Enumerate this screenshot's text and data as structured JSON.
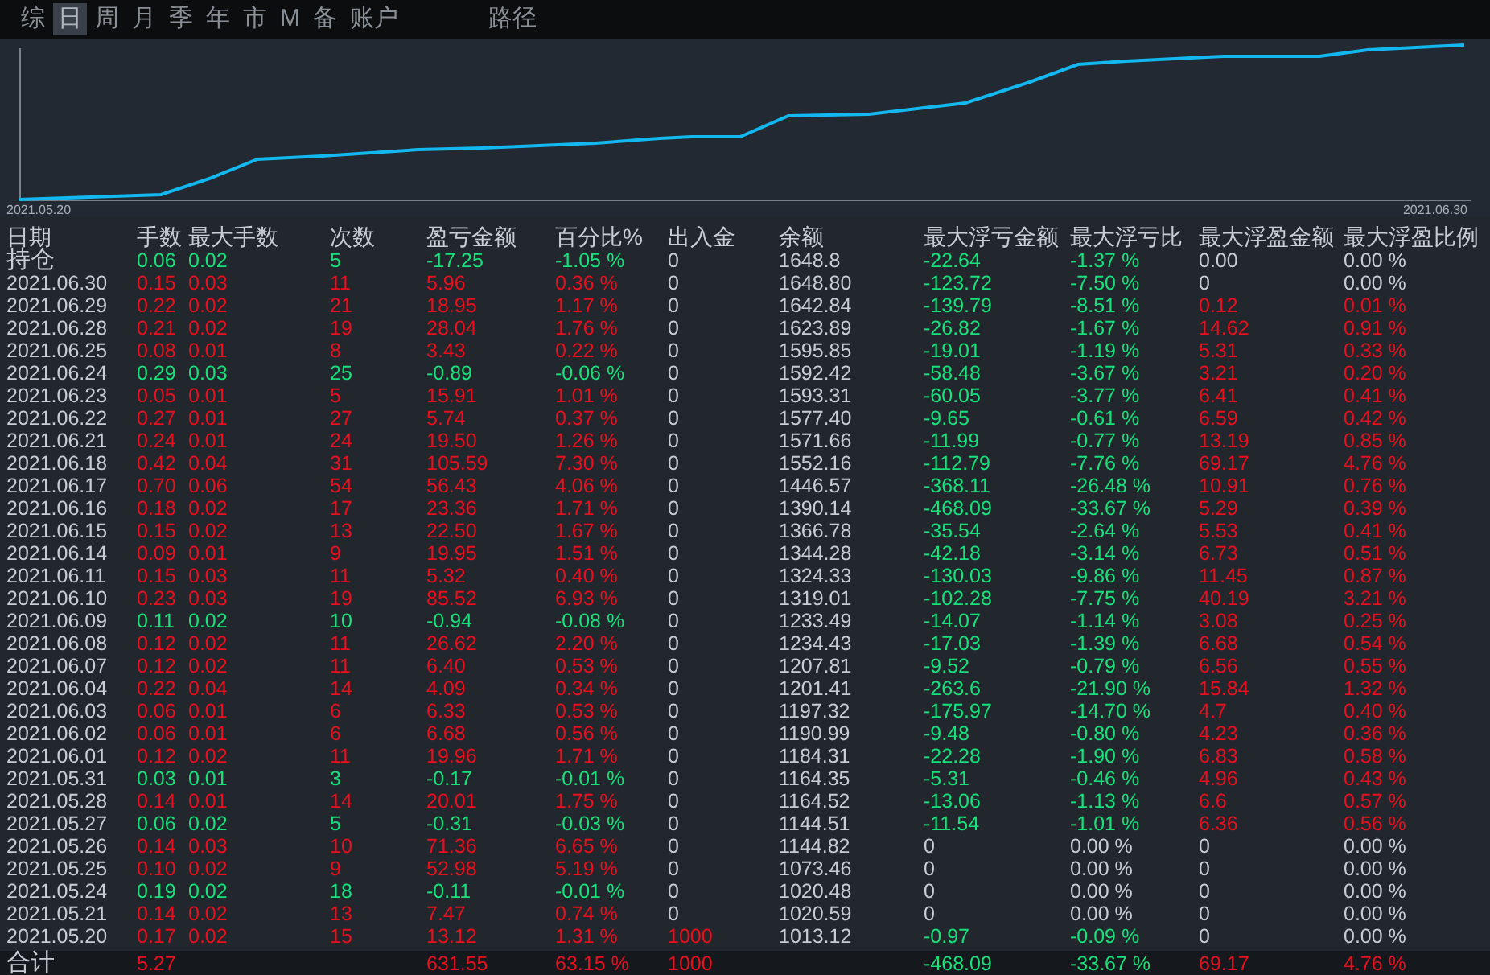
{
  "tabs": [
    {
      "label": "综",
      "selected": false
    },
    {
      "label": "日",
      "selected": true
    },
    {
      "label": "周",
      "selected": false
    },
    {
      "label": "月",
      "selected": false
    },
    {
      "label": "季",
      "selected": false
    },
    {
      "label": "年",
      "selected": false
    },
    {
      "label": "市",
      "selected": false
    },
    {
      "label": "M",
      "selected": false
    },
    {
      "label": "备",
      "selected": false
    },
    {
      "label": "账户",
      "selected": false
    },
    {
      "label": "路径",
      "selected": false
    }
  ],
  "chart": {
    "start_label": "2021.05.20",
    "end_label": "2021.06.30"
  },
  "table": {
    "columns": [
      "日期",
      "手数",
      "最大手数",
      "次数",
      "盈亏金额",
      "百分比%",
      "出入金",
      "余额",
      "最大浮亏金额",
      "最大浮亏比",
      "最大浮盈金额",
      "最大浮盈比例"
    ],
    "rows": [
      [
        {
          "text": "持仓",
          "color": "#c8ccd4"
        },
        {
          "text": "0.06",
          "color": "#18e07a"
        },
        {
          "text": "0.02",
          "color": "#18e07a"
        },
        {
          "text": "5",
          "color": "#18e07a"
        },
        {
          "text": "-17.25",
          "color": "#18e07a"
        },
        {
          "text": "-1.05 %",
          "color": "#18e07a"
        },
        {
          "text": "0",
          "color": "#c8ccd4"
        },
        {
          "text": "1648.8",
          "color": "#c8ccd4"
        },
        {
          "text": "-22.64",
          "color": "#18e07a"
        },
        {
          "text": "-1.37 %",
          "color": "#18e07a"
        },
        {
          "text": "0.00",
          "color": "#c8ccd4"
        },
        {
          "text": "0.00 %",
          "color": "#c8ccd4"
        }
      ],
      [
        {
          "text": "2021.06.30",
          "color": "#c8ccd4"
        },
        {
          "text": "0.15",
          "color": "#e8101e"
        },
        {
          "text": "0.03",
          "color": "#e8101e"
        },
        {
          "text": "11",
          "color": "#e8101e"
        },
        {
          "text": "5.96",
          "color": "#e8101e"
        },
        {
          "text": "0.36 %",
          "color": "#e8101e"
        },
        {
          "text": "0",
          "color": "#c8ccd4"
        },
        {
          "text": "1648.80",
          "color": "#c8ccd4"
        },
        {
          "text": "-123.72",
          "color": "#18e07a"
        },
        {
          "text": "-7.50 %",
          "color": "#18e07a"
        },
        {
          "text": "0",
          "color": "#c8ccd4"
        },
        {
          "text": "0.00 %",
          "color": "#c8ccd4"
        }
      ],
      [
        {
          "text": "2021.06.29",
          "color": "#c8ccd4"
        },
        {
          "text": "0.22",
          "color": "#e8101e"
        },
        {
          "text": "0.02",
          "color": "#e8101e"
        },
        {
          "text": "21",
          "color": "#e8101e"
        },
        {
          "text": "18.95",
          "color": "#e8101e"
        },
        {
          "text": "1.17 %",
          "color": "#e8101e"
        },
        {
          "text": "0",
          "color": "#c8ccd4"
        },
        {
          "text": "1642.84",
          "color": "#c8ccd4"
        },
        {
          "text": "-139.79",
          "color": "#18e07a"
        },
        {
          "text": "-8.51 %",
          "color": "#18e07a"
        },
        {
          "text": "0.12",
          "color": "#e8101e"
        },
        {
          "text": "0.01 %",
          "color": "#e8101e"
        }
      ],
      [
        {
          "text": "2021.06.28",
          "color": "#c8ccd4"
        },
        {
          "text": "0.21",
          "color": "#e8101e"
        },
        {
          "text": "0.02",
          "color": "#e8101e"
        },
        {
          "text": "19",
          "color": "#e8101e"
        },
        {
          "text": "28.04",
          "color": "#e8101e"
        },
        {
          "text": "1.76 %",
          "color": "#e8101e"
        },
        {
          "text": "0",
          "color": "#c8ccd4"
        },
        {
          "text": "1623.89",
          "color": "#c8ccd4"
        },
        {
          "text": "-26.82",
          "color": "#18e07a"
        },
        {
          "text": "-1.67 %",
          "color": "#18e07a"
        },
        {
          "text": "14.62",
          "color": "#e8101e"
        },
        {
          "text": "0.91 %",
          "color": "#e8101e"
        }
      ],
      [
        {
          "text": "2021.06.25",
          "color": "#c8ccd4"
        },
        {
          "text": "0.08",
          "color": "#e8101e"
        },
        {
          "text": "0.01",
          "color": "#e8101e"
        },
        {
          "text": "8",
          "color": "#e8101e"
        },
        {
          "text": "3.43",
          "color": "#e8101e"
        },
        {
          "text": "0.22 %",
          "color": "#e8101e"
        },
        {
          "text": "0",
          "color": "#c8ccd4"
        },
        {
          "text": "1595.85",
          "color": "#c8ccd4"
        },
        {
          "text": "-19.01",
          "color": "#18e07a"
        },
        {
          "text": "-1.19 %",
          "color": "#18e07a"
        },
        {
          "text": "5.31",
          "color": "#e8101e"
        },
        {
          "text": "0.33 %",
          "color": "#e8101e"
        }
      ],
      [
        {
          "text": "2021.06.24",
          "color": "#c8ccd4"
        },
        {
          "text": "0.29",
          "color": "#18e07a"
        },
        {
          "text": "0.03",
          "color": "#18e07a"
        },
        {
          "text": "25",
          "color": "#18e07a"
        },
        {
          "text": "-0.89",
          "color": "#18e07a"
        },
        {
          "text": "-0.06 %",
          "color": "#18e07a"
        },
        {
          "text": "0",
          "color": "#c8ccd4"
        },
        {
          "text": "1592.42",
          "color": "#c8ccd4"
        },
        {
          "text": "-58.48",
          "color": "#18e07a"
        },
        {
          "text": "-3.67 %",
          "color": "#18e07a"
        },
        {
          "text": "3.21",
          "color": "#e8101e"
        },
        {
          "text": "0.20 %",
          "color": "#e8101e"
        }
      ],
      [
        {
          "text": "2021.06.23",
          "color": "#c8ccd4"
        },
        {
          "text": "0.05",
          "color": "#e8101e"
        },
        {
          "text": "0.01",
          "color": "#e8101e"
        },
        {
          "text": "5",
          "color": "#e8101e"
        },
        {
          "text": "15.91",
          "color": "#e8101e"
        },
        {
          "text": "1.01 %",
          "color": "#e8101e"
        },
        {
          "text": "0",
          "color": "#c8ccd4"
        },
        {
          "text": "1593.31",
          "color": "#c8ccd4"
        },
        {
          "text": "-60.05",
          "color": "#18e07a"
        },
        {
          "text": "-3.77 %",
          "color": "#18e07a"
        },
        {
          "text": "6.41",
          "color": "#e8101e"
        },
        {
          "text": "0.41 %",
          "color": "#e8101e"
        }
      ],
      [
        {
          "text": "2021.06.22",
          "color": "#c8ccd4"
        },
        {
          "text": "0.27",
          "color": "#e8101e"
        },
        {
          "text": "0.01",
          "color": "#e8101e"
        },
        {
          "text": "27",
          "color": "#e8101e"
        },
        {
          "text": "5.74",
          "color": "#e8101e"
        },
        {
          "text": "0.37 %",
          "color": "#e8101e"
        },
        {
          "text": "0",
          "color": "#c8ccd4"
        },
        {
          "text": "1577.40",
          "color": "#c8ccd4"
        },
        {
          "text": "-9.65",
          "color": "#18e07a"
        },
        {
          "text": "-0.61 %",
          "color": "#18e07a"
        },
        {
          "text": "6.59",
          "color": "#e8101e"
        },
        {
          "text": "0.42 %",
          "color": "#e8101e"
        }
      ],
      [
        {
          "text": "2021.06.21",
          "color": "#c8ccd4"
        },
        {
          "text": "0.24",
          "color": "#e8101e"
        },
        {
          "text": "0.01",
          "color": "#e8101e"
        },
        {
          "text": "24",
          "color": "#e8101e"
        },
        {
          "text": "19.50",
          "color": "#e8101e"
        },
        {
          "text": "1.26 %",
          "color": "#e8101e"
        },
        {
          "text": "0",
          "color": "#c8ccd4"
        },
        {
          "text": "1571.66",
          "color": "#c8ccd4"
        },
        {
          "text": "-11.99",
          "color": "#18e07a"
        },
        {
          "text": "-0.77 %",
          "color": "#18e07a"
        },
        {
          "text": "13.19",
          "color": "#e8101e"
        },
        {
          "text": "0.85 %",
          "color": "#e8101e"
        }
      ],
      [
        {
          "text": "2021.06.18",
          "color": "#c8ccd4"
        },
        {
          "text": "0.42",
          "color": "#e8101e"
        },
        {
          "text": "0.04",
          "color": "#e8101e"
        },
        {
          "text": "31",
          "color": "#e8101e"
        },
        {
          "text": "105.59",
          "color": "#e8101e"
        },
        {
          "text": "7.30 %",
          "color": "#e8101e"
        },
        {
          "text": "0",
          "color": "#c8ccd4"
        },
        {
          "text": "1552.16",
          "color": "#c8ccd4"
        },
        {
          "text": "-112.79",
          "color": "#18e07a"
        },
        {
          "text": "-7.76 %",
          "color": "#18e07a"
        },
        {
          "text": "69.17",
          "color": "#e8101e"
        },
        {
          "text": "4.76 %",
          "color": "#e8101e"
        }
      ],
      [
        {
          "text": "2021.06.17",
          "color": "#c8ccd4"
        },
        {
          "text": "0.70",
          "color": "#e8101e"
        },
        {
          "text": "0.06",
          "color": "#e8101e"
        },
        {
          "text": "54",
          "color": "#e8101e"
        },
        {
          "text": "56.43",
          "color": "#e8101e"
        },
        {
          "text": "4.06 %",
          "color": "#e8101e"
        },
        {
          "text": "0",
          "color": "#c8ccd4"
        },
        {
          "text": "1446.57",
          "color": "#c8ccd4"
        },
        {
          "text": "-368.11",
          "color": "#18e07a"
        },
        {
          "text": "-26.48 %",
          "color": "#18e07a"
        },
        {
          "text": "10.91",
          "color": "#e8101e"
        },
        {
          "text": "0.76 %",
          "color": "#e8101e"
        }
      ],
      [
        {
          "text": "2021.06.16",
          "color": "#c8ccd4"
        },
        {
          "text": "0.18",
          "color": "#e8101e"
        },
        {
          "text": "0.02",
          "color": "#e8101e"
        },
        {
          "text": "17",
          "color": "#e8101e"
        },
        {
          "text": "23.36",
          "color": "#e8101e"
        },
        {
          "text": "1.71 %",
          "color": "#e8101e"
        },
        {
          "text": "0",
          "color": "#c8ccd4"
        },
        {
          "text": "1390.14",
          "color": "#c8ccd4"
        },
        {
          "text": "-468.09",
          "color": "#18e07a"
        },
        {
          "text": "-33.67 %",
          "color": "#18e07a"
        },
        {
          "text": "5.29",
          "color": "#e8101e"
        },
        {
          "text": "0.39 %",
          "color": "#e8101e"
        }
      ],
      [
        {
          "text": "2021.06.15",
          "color": "#c8ccd4"
        },
        {
          "text": "0.15",
          "color": "#e8101e"
        },
        {
          "text": "0.02",
          "color": "#e8101e"
        },
        {
          "text": "13",
          "color": "#e8101e"
        },
        {
          "text": "22.50",
          "color": "#e8101e"
        },
        {
          "text": "1.67 %",
          "color": "#e8101e"
        },
        {
          "text": "0",
          "color": "#c8ccd4"
        },
        {
          "text": "1366.78",
          "color": "#c8ccd4"
        },
        {
          "text": "-35.54",
          "color": "#18e07a"
        },
        {
          "text": "-2.64 %",
          "color": "#18e07a"
        },
        {
          "text": "5.53",
          "color": "#e8101e"
        },
        {
          "text": "0.41 %",
          "color": "#e8101e"
        }
      ],
      [
        {
          "text": "2021.06.14",
          "color": "#c8ccd4"
        },
        {
          "text": "0.09",
          "color": "#e8101e"
        },
        {
          "text": "0.01",
          "color": "#e8101e"
        },
        {
          "text": "9",
          "color": "#e8101e"
        },
        {
          "text": "19.95",
          "color": "#e8101e"
        },
        {
          "text": "1.51 %",
          "color": "#e8101e"
        },
        {
          "text": "0",
          "color": "#c8ccd4"
        },
        {
          "text": "1344.28",
          "color": "#c8ccd4"
        },
        {
          "text": "-42.18",
          "color": "#18e07a"
        },
        {
          "text": "-3.14 %",
          "color": "#18e07a"
        },
        {
          "text": "6.73",
          "color": "#e8101e"
        },
        {
          "text": "0.51 %",
          "color": "#e8101e"
        }
      ],
      [
        {
          "text": "2021.06.11",
          "color": "#c8ccd4"
        },
        {
          "text": "0.15",
          "color": "#e8101e"
        },
        {
          "text": "0.03",
          "color": "#e8101e"
        },
        {
          "text": "11",
          "color": "#e8101e"
        },
        {
          "text": "5.32",
          "color": "#e8101e"
        },
        {
          "text": "0.40 %",
          "color": "#e8101e"
        },
        {
          "text": "0",
          "color": "#c8ccd4"
        },
        {
          "text": "1324.33",
          "color": "#c8ccd4"
        },
        {
          "text": "-130.03",
          "color": "#18e07a"
        },
        {
          "text": "-9.86 %",
          "color": "#18e07a"
        },
        {
          "text": "11.45",
          "color": "#e8101e"
        },
        {
          "text": "0.87 %",
          "color": "#e8101e"
        }
      ],
      [
        {
          "text": "2021.06.10",
          "color": "#c8ccd4"
        },
        {
          "text": "0.23",
          "color": "#e8101e"
        },
        {
          "text": "0.03",
          "color": "#e8101e"
        },
        {
          "text": "19",
          "color": "#e8101e"
        },
        {
          "text": "85.52",
          "color": "#e8101e"
        },
        {
          "text": "6.93 %",
          "color": "#e8101e"
        },
        {
          "text": "0",
          "color": "#c8ccd4"
        },
        {
          "text": "1319.01",
          "color": "#c8ccd4"
        },
        {
          "text": "-102.28",
          "color": "#18e07a"
        },
        {
          "text": "-7.75 %",
          "color": "#18e07a"
        },
        {
          "text": "40.19",
          "color": "#e8101e"
        },
        {
          "text": "3.21 %",
          "color": "#e8101e"
        }
      ],
      [
        {
          "text": "2021.06.09",
          "color": "#c8ccd4"
        },
        {
          "text": "0.11",
          "color": "#18e07a"
        },
        {
          "text": "0.02",
          "color": "#18e07a"
        },
        {
          "text": "10",
          "color": "#18e07a"
        },
        {
          "text": "-0.94",
          "color": "#18e07a"
        },
        {
          "text": "-0.08 %",
          "color": "#18e07a"
        },
        {
          "text": "0",
          "color": "#c8ccd4"
        },
        {
          "text": "1233.49",
          "color": "#c8ccd4"
        },
        {
          "text": "-14.07",
          "color": "#18e07a"
        },
        {
          "text": "-1.14 %",
          "color": "#18e07a"
        },
        {
          "text": "3.08",
          "color": "#e8101e"
        },
        {
          "text": "0.25 %",
          "color": "#e8101e"
        }
      ],
      [
        {
          "text": "2021.06.08",
          "color": "#c8ccd4"
        },
        {
          "text": "0.12",
          "color": "#e8101e"
        },
        {
          "text": "0.02",
          "color": "#e8101e"
        },
        {
          "text": "11",
          "color": "#e8101e"
        },
        {
          "text": "26.62",
          "color": "#e8101e"
        },
        {
          "text": "2.20 %",
          "color": "#e8101e"
        },
        {
          "text": "0",
          "color": "#c8ccd4"
        },
        {
          "text": "1234.43",
          "color": "#c8ccd4"
        },
        {
          "text": "-17.03",
          "color": "#18e07a"
        },
        {
          "text": "-1.39 %",
          "color": "#18e07a"
        },
        {
          "text": "6.68",
          "color": "#e8101e"
        },
        {
          "text": "0.54 %",
          "color": "#e8101e"
        }
      ],
      [
        {
          "text": "2021.06.07",
          "color": "#c8ccd4"
        },
        {
          "text": "0.12",
          "color": "#e8101e"
        },
        {
          "text": "0.02",
          "color": "#e8101e"
        },
        {
          "text": "11",
          "color": "#e8101e"
        },
        {
          "text": "6.40",
          "color": "#e8101e"
        },
        {
          "text": "0.53 %",
          "color": "#e8101e"
        },
        {
          "text": "0",
          "color": "#c8ccd4"
        },
        {
          "text": "1207.81",
          "color": "#c8ccd4"
        },
        {
          "text": "-9.52",
          "color": "#18e07a"
        },
        {
          "text": "-0.79 %",
          "color": "#18e07a"
        },
        {
          "text": "6.56",
          "color": "#e8101e"
        },
        {
          "text": "0.55 %",
          "color": "#e8101e"
        }
      ],
      [
        {
          "text": "2021.06.04",
          "color": "#c8ccd4"
        },
        {
          "text": "0.22",
          "color": "#e8101e"
        },
        {
          "text": "0.04",
          "color": "#e8101e"
        },
        {
          "text": "14",
          "color": "#e8101e"
        },
        {
          "text": "4.09",
          "color": "#e8101e"
        },
        {
          "text": "0.34 %",
          "color": "#e8101e"
        },
        {
          "text": "0",
          "color": "#c8ccd4"
        },
        {
          "text": "1201.41",
          "color": "#c8ccd4"
        },
        {
          "text": "-263.6",
          "color": "#18e07a"
        },
        {
          "text": "-21.90 %",
          "color": "#18e07a"
        },
        {
          "text": "15.84",
          "color": "#e8101e"
        },
        {
          "text": "1.32 %",
          "color": "#e8101e"
        }
      ],
      [
        {
          "text": "2021.06.03",
          "color": "#c8ccd4"
        },
        {
          "text": "0.06",
          "color": "#e8101e"
        },
        {
          "text": "0.01",
          "color": "#e8101e"
        },
        {
          "text": "6",
          "color": "#e8101e"
        },
        {
          "text": "6.33",
          "color": "#e8101e"
        },
        {
          "text": "0.53 %",
          "color": "#e8101e"
        },
        {
          "text": "0",
          "color": "#c8ccd4"
        },
        {
          "text": "1197.32",
          "color": "#c8ccd4"
        },
        {
          "text": "-175.97",
          "color": "#18e07a"
        },
        {
          "text": "-14.70 %",
          "color": "#18e07a"
        },
        {
          "text": "4.7",
          "color": "#e8101e"
        },
        {
          "text": "0.40 %",
          "color": "#e8101e"
        }
      ],
      [
        {
          "text": "2021.06.02",
          "color": "#c8ccd4"
        },
        {
          "text": "0.06",
          "color": "#e8101e"
        },
        {
          "text": "0.01",
          "color": "#e8101e"
        },
        {
          "text": "6",
          "color": "#e8101e"
        },
        {
          "text": "6.68",
          "color": "#e8101e"
        },
        {
          "text": "0.56 %",
          "color": "#e8101e"
        },
        {
          "text": "0",
          "color": "#c8ccd4"
        },
        {
          "text": "1190.99",
          "color": "#c8ccd4"
        },
        {
          "text": "-9.48",
          "color": "#18e07a"
        },
        {
          "text": "-0.80 %",
          "color": "#18e07a"
        },
        {
          "text": "4.23",
          "color": "#e8101e"
        },
        {
          "text": "0.36 %",
          "color": "#e8101e"
        }
      ],
      [
        {
          "text": "2021.06.01",
          "color": "#c8ccd4"
        },
        {
          "text": "0.12",
          "color": "#e8101e"
        },
        {
          "text": "0.02",
          "color": "#e8101e"
        },
        {
          "text": "11",
          "color": "#e8101e"
        },
        {
          "text": "19.96",
          "color": "#e8101e"
        },
        {
          "text": "1.71 %",
          "color": "#e8101e"
        },
        {
          "text": "0",
          "color": "#c8ccd4"
        },
        {
          "text": "1184.31",
          "color": "#c8ccd4"
        },
        {
          "text": "-22.28",
          "color": "#18e07a"
        },
        {
          "text": "-1.90 %",
          "color": "#18e07a"
        },
        {
          "text": "6.83",
          "color": "#e8101e"
        },
        {
          "text": "0.58 %",
          "color": "#e8101e"
        }
      ],
      [
        {
          "text": "2021.05.31",
          "color": "#c8ccd4"
        },
        {
          "text": "0.03",
          "color": "#18e07a"
        },
        {
          "text": "0.01",
          "color": "#18e07a"
        },
        {
          "text": "3",
          "color": "#18e07a"
        },
        {
          "text": "-0.17",
          "color": "#18e07a"
        },
        {
          "text": "-0.01 %",
          "color": "#18e07a"
        },
        {
          "text": "0",
          "color": "#c8ccd4"
        },
        {
          "text": "1164.35",
          "color": "#c8ccd4"
        },
        {
          "text": "-5.31",
          "color": "#18e07a"
        },
        {
          "text": "-0.46 %",
          "color": "#18e07a"
        },
        {
          "text": "4.96",
          "color": "#e8101e"
        },
        {
          "text": "0.43 %",
          "color": "#e8101e"
        }
      ],
      [
        {
          "text": "2021.05.28",
          "color": "#c8ccd4"
        },
        {
          "text": "0.14",
          "color": "#e8101e"
        },
        {
          "text": "0.01",
          "color": "#e8101e"
        },
        {
          "text": "14",
          "color": "#e8101e"
        },
        {
          "text": "20.01",
          "color": "#e8101e"
        },
        {
          "text": "1.75 %",
          "color": "#e8101e"
        },
        {
          "text": "0",
          "color": "#c8ccd4"
        },
        {
          "text": "1164.52",
          "color": "#c8ccd4"
        },
        {
          "text": "-13.06",
          "color": "#18e07a"
        },
        {
          "text": "-1.13 %",
          "color": "#18e07a"
        },
        {
          "text": "6.6",
          "color": "#e8101e"
        },
        {
          "text": "0.57 %",
          "color": "#e8101e"
        }
      ],
      [
        {
          "text": "2021.05.27",
          "color": "#c8ccd4"
        },
        {
          "text": "0.06",
          "color": "#18e07a"
        },
        {
          "text": "0.02",
          "color": "#18e07a"
        },
        {
          "text": "5",
          "color": "#18e07a"
        },
        {
          "text": "-0.31",
          "color": "#18e07a"
        },
        {
          "text": "-0.03 %",
          "color": "#18e07a"
        },
        {
          "text": "0",
          "color": "#c8ccd4"
        },
        {
          "text": "1144.51",
          "color": "#c8ccd4"
        },
        {
          "text": "-11.54",
          "color": "#18e07a"
        },
        {
          "text": "-1.01 %",
          "color": "#18e07a"
        },
        {
          "text": "6.36",
          "color": "#e8101e"
        },
        {
          "text": "0.56 %",
          "color": "#e8101e"
        }
      ],
      [
        {
          "text": "2021.05.26",
          "color": "#c8ccd4"
        },
        {
          "text": "0.14",
          "color": "#e8101e"
        },
        {
          "text": "0.03",
          "color": "#e8101e"
        },
        {
          "text": "10",
          "color": "#e8101e"
        },
        {
          "text": "71.36",
          "color": "#e8101e"
        },
        {
          "text": "6.65 %",
          "color": "#e8101e"
        },
        {
          "text": "0",
          "color": "#c8ccd4"
        },
        {
          "text": "1144.82",
          "color": "#c8ccd4"
        },
        {
          "text": "0",
          "color": "#c8ccd4"
        },
        {
          "text": "0.00 %",
          "color": "#c8ccd4"
        },
        {
          "text": "0",
          "color": "#c8ccd4"
        },
        {
          "text": "0.00 %",
          "color": "#c8ccd4"
        }
      ],
      [
        {
          "text": "2021.05.25",
          "color": "#c8ccd4"
        },
        {
          "text": "0.10",
          "color": "#e8101e"
        },
        {
          "text": "0.02",
          "color": "#e8101e"
        },
        {
          "text": "9",
          "color": "#e8101e"
        },
        {
          "text": "52.98",
          "color": "#e8101e"
        },
        {
          "text": "5.19 %",
          "color": "#e8101e"
        },
        {
          "text": "0",
          "color": "#c8ccd4"
        },
        {
          "text": "1073.46",
          "color": "#c8ccd4"
        },
        {
          "text": "0",
          "color": "#c8ccd4"
        },
        {
          "text": "0.00 %",
          "color": "#c8ccd4"
        },
        {
          "text": "0",
          "color": "#c8ccd4"
        },
        {
          "text": "0.00 %",
          "color": "#c8ccd4"
        }
      ],
      [
        {
          "text": "2021.05.24",
          "color": "#c8ccd4"
        },
        {
          "text": "0.19",
          "color": "#18e07a"
        },
        {
          "text": "0.02",
          "color": "#18e07a"
        },
        {
          "text": "18",
          "color": "#18e07a"
        },
        {
          "text": "-0.11",
          "color": "#18e07a"
        },
        {
          "text": "-0.01 %",
          "color": "#18e07a"
        },
        {
          "text": "0",
          "color": "#c8ccd4"
        },
        {
          "text": "1020.48",
          "color": "#c8ccd4"
        },
        {
          "text": "0",
          "color": "#c8ccd4"
        },
        {
          "text": "0.00 %",
          "color": "#c8ccd4"
        },
        {
          "text": "0",
          "color": "#c8ccd4"
        },
        {
          "text": "0.00 %",
          "color": "#c8ccd4"
        }
      ],
      [
        {
          "text": "2021.05.21",
          "color": "#c8ccd4"
        },
        {
          "text": "0.14",
          "color": "#e8101e"
        },
        {
          "text": "0.02",
          "color": "#e8101e"
        },
        {
          "text": "13",
          "color": "#e8101e"
        },
        {
          "text": "7.47",
          "color": "#e8101e"
        },
        {
          "text": "0.74 %",
          "color": "#e8101e"
        },
        {
          "text": "0",
          "color": "#c8ccd4"
        },
        {
          "text": "1020.59",
          "color": "#c8ccd4"
        },
        {
          "text": "0",
          "color": "#c8ccd4"
        },
        {
          "text": "0.00 %",
          "color": "#c8ccd4"
        },
        {
          "text": "0",
          "color": "#c8ccd4"
        },
        {
          "text": "0.00 %",
          "color": "#c8ccd4"
        }
      ],
      [
        {
          "text": "2021.05.20",
          "color": "#c8ccd4"
        },
        {
          "text": "0.17",
          "color": "#e8101e"
        },
        {
          "text": "0.02",
          "color": "#e8101e"
        },
        {
          "text": "15",
          "color": "#e8101e"
        },
        {
          "text": "13.12",
          "color": "#e8101e"
        },
        {
          "text": "1.31 %",
          "color": "#e8101e"
        },
        {
          "text": "1000",
          "color": "#e8101e"
        },
        {
          "text": "1013.12",
          "color": "#c8ccd4"
        },
        {
          "text": "-0.97",
          "color": "#18e07a"
        },
        {
          "text": "-0.09 %",
          "color": "#18e07a"
        },
        {
          "text": "0",
          "color": "#c8ccd4"
        },
        {
          "text": "0.00 %",
          "color": "#c8ccd4"
        }
      ]
    ],
    "total": {
      "label": {
        "text": "合计",
        "color": "#c8ccd4"
      },
      "lots": {
        "text": "5.27",
        "color": "#e8101e"
      },
      "pnl": {
        "text": "631.55",
        "color": "#e8101e"
      },
      "pct": {
        "text": "63.15 %",
        "color": "#e8101e"
      },
      "flow": {
        "text": "1000",
        "color": "#e8101e"
      },
      "max_loss": {
        "text": "-468.09",
        "color": "#18e07a"
      },
      "max_loss_pct": {
        "text": "-33.67 %",
        "color": "#18e07a"
      },
      "max_gain": {
        "text": "69.17",
        "color": "#e8101e"
      },
      "max_gain_pct": {
        "text": "4.76 %",
        "color": "#e8101e"
      }
    }
  }
}
